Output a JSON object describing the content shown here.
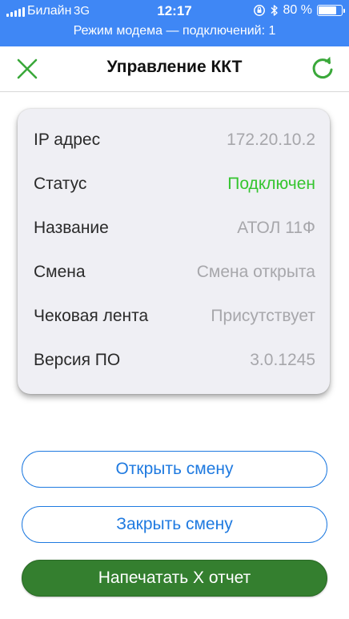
{
  "status_bar": {
    "carrier": "Билайн",
    "network": "3G",
    "time": "12:17",
    "battery_text": "80 %",
    "battery_level": 0.8,
    "hotspot_text": "Режим модема — подключений: 1",
    "color": "#3f87f5"
  },
  "nav": {
    "title": "Управление ККТ",
    "close_icon": "close-icon",
    "refresh_icon": "refresh-icon",
    "accent": "#3aa83a"
  },
  "info": {
    "rows": [
      {
        "label": "IP адрес",
        "value": "172.20.10.2"
      },
      {
        "label": "Статус",
        "value": "Подключен",
        "value_color": "#35c52f"
      },
      {
        "label": "Название",
        "value": "АТОЛ 11Ф"
      },
      {
        "label": "Смена",
        "value": "Смена открыта"
      },
      {
        "label": "Чековая лента",
        "value": "Присутствует"
      },
      {
        "label": "Версия ПО",
        "value": "3.0.1245"
      }
    ]
  },
  "actions": {
    "open_shift": "Открыть смену",
    "close_shift": "Закрыть смену",
    "print_x_report": "Напечатать Х отчет"
  }
}
